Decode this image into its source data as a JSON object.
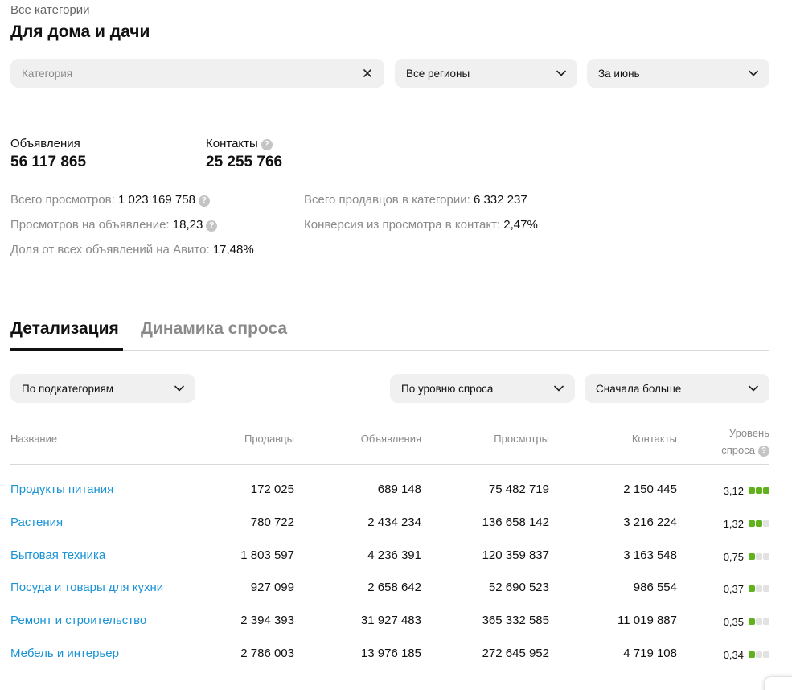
{
  "header": {
    "breadcrumb": "Все категории",
    "title": "Для дома и дачи"
  },
  "filters": {
    "category_placeholder": "Категория",
    "region": "Все регионы",
    "period": "За июнь"
  },
  "stats": {
    "ads_label": "Объявления",
    "ads_value": "56 117 865",
    "contacts_label": "Контакты",
    "contacts_value": "25 255 766"
  },
  "metrics": {
    "views_label": "Всего просмотров:",
    "views_value": "1 023 169 758",
    "views_per_ad_label": "Просмотров на объявление:",
    "views_per_ad_value": "18,23",
    "share_label": "Доля от всех объявлений на Авито:",
    "share_value": "17,48%",
    "sellers_label": "Всего продавцов в категории:",
    "sellers_value": "6 332 237",
    "conversion_label": "Конверсия из просмотра в контакт:",
    "conversion_value": "2,47%"
  },
  "tabs": {
    "details": "Детализация",
    "dynamics": "Динамика спроса"
  },
  "table_controls": {
    "group_by": "По подкатегориям",
    "sort_by": "По уровню спроса",
    "order": "Сначала больше"
  },
  "table": {
    "headers": {
      "name": "Название",
      "sellers": "Продавцы",
      "ads": "Объявления",
      "views": "Просмотры",
      "contacts": "Контакты",
      "demand_line1": "Уровень",
      "demand_line2": "спроса"
    },
    "rows": [
      {
        "name": "Продукты питания",
        "sellers": "172 025",
        "ads": "689 148",
        "views": "75 482 719",
        "contacts": "2 150 445",
        "demand": "3,12",
        "level": 3
      },
      {
        "name": "Растения",
        "sellers": "780 722",
        "ads": "2 434 234",
        "views": "136 658 142",
        "contacts": "3 216 224",
        "demand": "1,32",
        "level": 2
      },
      {
        "name": "Бытовая техника",
        "sellers": "1 803 597",
        "ads": "4 236 391",
        "views": "120 359 837",
        "contacts": "3 163 548",
        "demand": "0,75",
        "level": 1
      },
      {
        "name": "Посуда и товары для кухни",
        "sellers": "927 099",
        "ads": "2 658 642",
        "views": "52 690 523",
        "contacts": "986 554",
        "demand": "0,37",
        "level": 1
      },
      {
        "name": "Ремонт и строительство",
        "sellers": "2 394 393",
        "ads": "31 927 483",
        "views": "365 332 585",
        "contacts": "11 019 887",
        "demand": "0,35",
        "level": 1
      },
      {
        "name": "Мебель и интерьер",
        "sellers": "2 786 003",
        "ads": "13 976 185",
        "views": "272 645 952",
        "contacts": "4 719 108",
        "demand": "0,34",
        "level": 1
      }
    ]
  },
  "colors": {
    "link": "#1a93d6",
    "demand_on": "#5fb21b",
    "demand_off": "#e2e2e2"
  }
}
